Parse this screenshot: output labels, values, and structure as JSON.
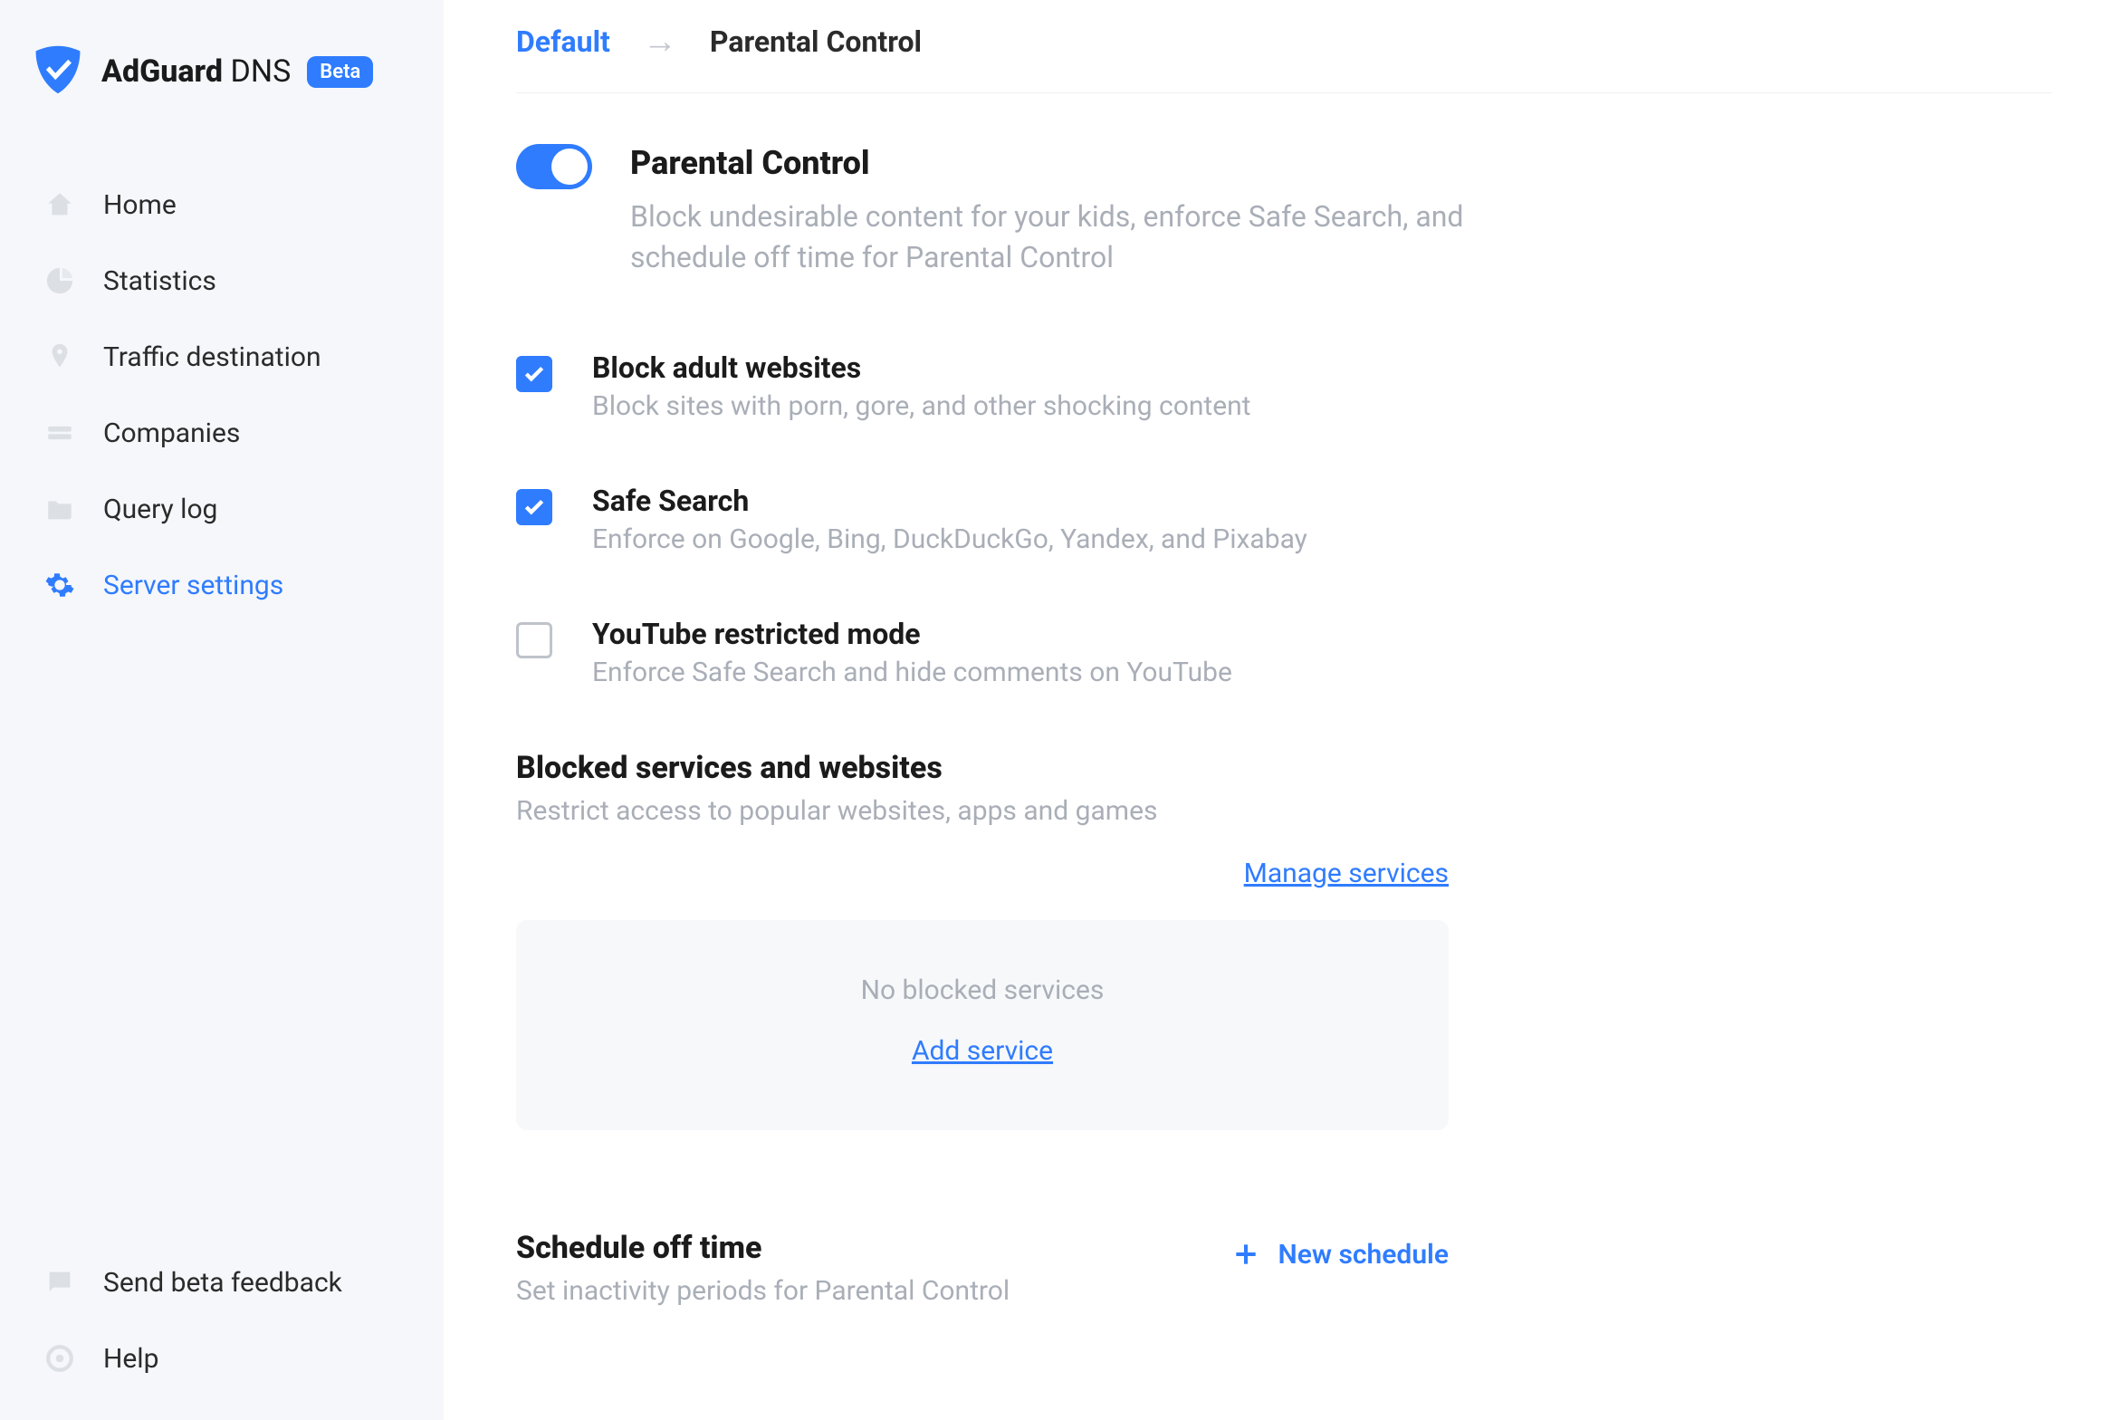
{
  "brand": {
    "name_bold": "AdGuard",
    "name_light": "DNS",
    "badge": "Beta"
  },
  "sidebar": {
    "items": [
      {
        "label": "Home"
      },
      {
        "label": "Statistics"
      },
      {
        "label": "Traffic destination"
      },
      {
        "label": "Companies"
      },
      {
        "label": "Query log"
      },
      {
        "label": "Server settings"
      }
    ],
    "footer": [
      {
        "label": "Send beta feedback"
      },
      {
        "label": "Help"
      }
    ]
  },
  "breadcrumb": {
    "root": "Default",
    "current": "Parental Control"
  },
  "header": {
    "title": "Parental Control",
    "subtitle": "Block undesirable content for your kids, enforce Safe Search, and schedule off time for Parental Control"
  },
  "options": [
    {
      "title": "Block adult websites",
      "desc": "Block sites with porn, gore, and other shocking content",
      "checked": true
    },
    {
      "title": "Safe Search",
      "desc": "Enforce on Google, Bing, DuckDuckGo, Yandex, and Pixabay",
      "checked": true
    },
    {
      "title": "YouTube restricted mode",
      "desc": "Enforce Safe Search and hide comments on YouTube",
      "checked": false
    }
  ],
  "blocked": {
    "title": "Blocked services and websites",
    "desc": "Restrict access to popular websites, apps and games",
    "manage": "Manage services",
    "empty": "No blocked services",
    "add": "Add service"
  },
  "schedule": {
    "title": "Schedule off time",
    "desc": "Set inactivity periods for Parental Control",
    "new": "New schedule"
  }
}
